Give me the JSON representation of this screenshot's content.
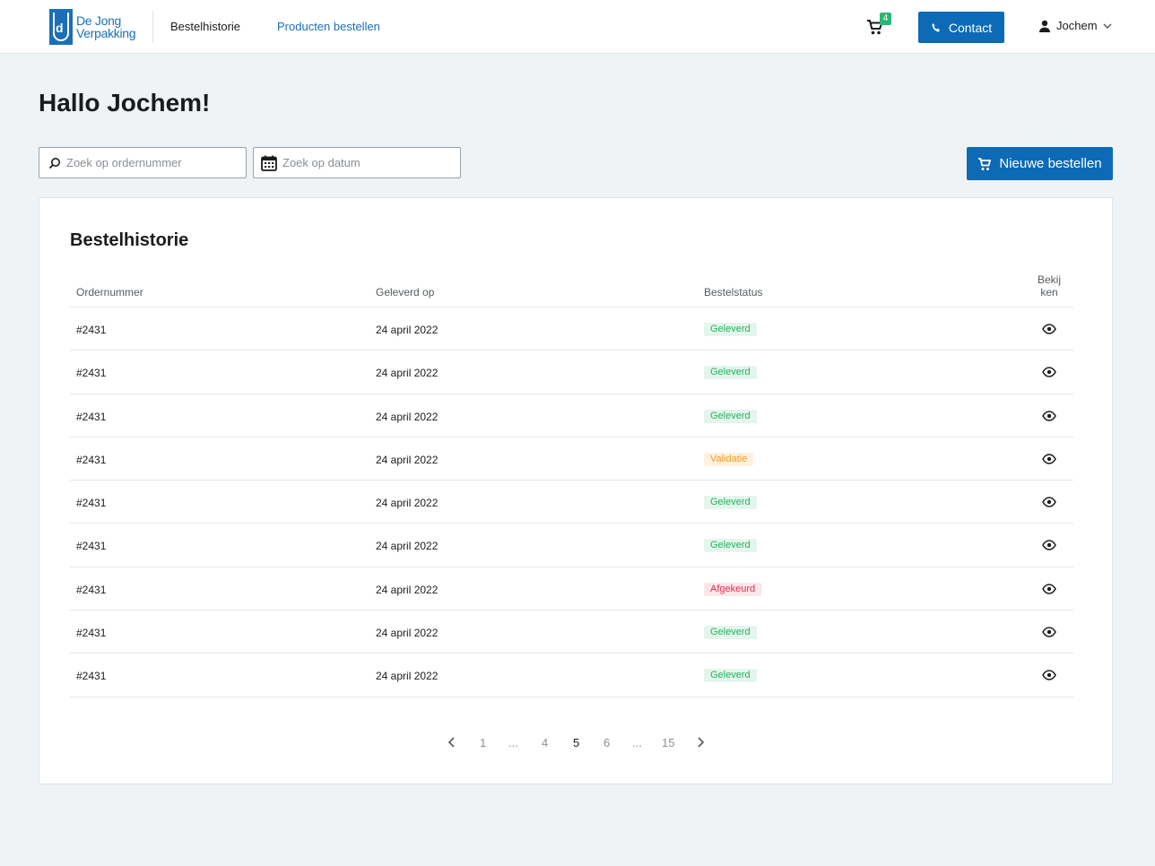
{
  "header": {
    "logo_line1": "De Jong",
    "logo_line2": "Verpakking",
    "logo_letter": "d",
    "nav": {
      "history": "Bestelhistorie",
      "order_products": "Producten bestellen"
    },
    "cart_count": "4",
    "contact_label": "Contact",
    "user_name": "Jochem"
  },
  "greeting": "Hallo Jochem!",
  "search": {
    "order_placeholder": "Zoek op ordernummer",
    "date_placeholder": "Zoek op datum"
  },
  "new_order_label": "Nieuwe bestellen",
  "card": {
    "title": "Bestelhistorie",
    "columns": {
      "order": "Ordernummer",
      "delivered": "Geleverd op",
      "status": "Bestelstatus",
      "view_line1": "Bekij",
      "view_line2": "ken"
    },
    "rows": [
      {
        "order": "#2431",
        "date": "24 april 2022",
        "status": "Geleverd"
      },
      {
        "order": "#2431",
        "date": "24 april 2022",
        "status": "Geleverd"
      },
      {
        "order": "#2431",
        "date": "24 april 2022",
        "status": "Geleverd"
      },
      {
        "order": "#2431",
        "date": "24 april 2022",
        "status": "Validatie"
      },
      {
        "order": "#2431",
        "date": "24 april 2022",
        "status": "Geleverd"
      },
      {
        "order": "#2431",
        "date": "24 april 2022",
        "status": "Geleverd"
      },
      {
        "order": "#2431",
        "date": "24 april 2022",
        "status": "Afgekeurd"
      },
      {
        "order": "#2431",
        "date": "24 april 2022",
        "status": "Geleverd"
      },
      {
        "order": "#2431",
        "date": "24 april 2022",
        "status": "Geleverd"
      }
    ]
  },
  "pagination": {
    "p1": "1",
    "e1": "...",
    "p4": "4",
    "p5": "5",
    "p6": "6",
    "e2": "...",
    "p15": "15"
  },
  "colors": {
    "primary": "#0d6ab6",
    "badge_green": "#22b25c",
    "badge_orange": "#f39a1c",
    "badge_red": "#e0304e"
  },
  "icons": {
    "cart": "cart-icon",
    "phone": "phone-icon",
    "user": "user-icon",
    "search": "search-icon",
    "calendar": "calendar-icon",
    "eye": "eye-icon"
  }
}
